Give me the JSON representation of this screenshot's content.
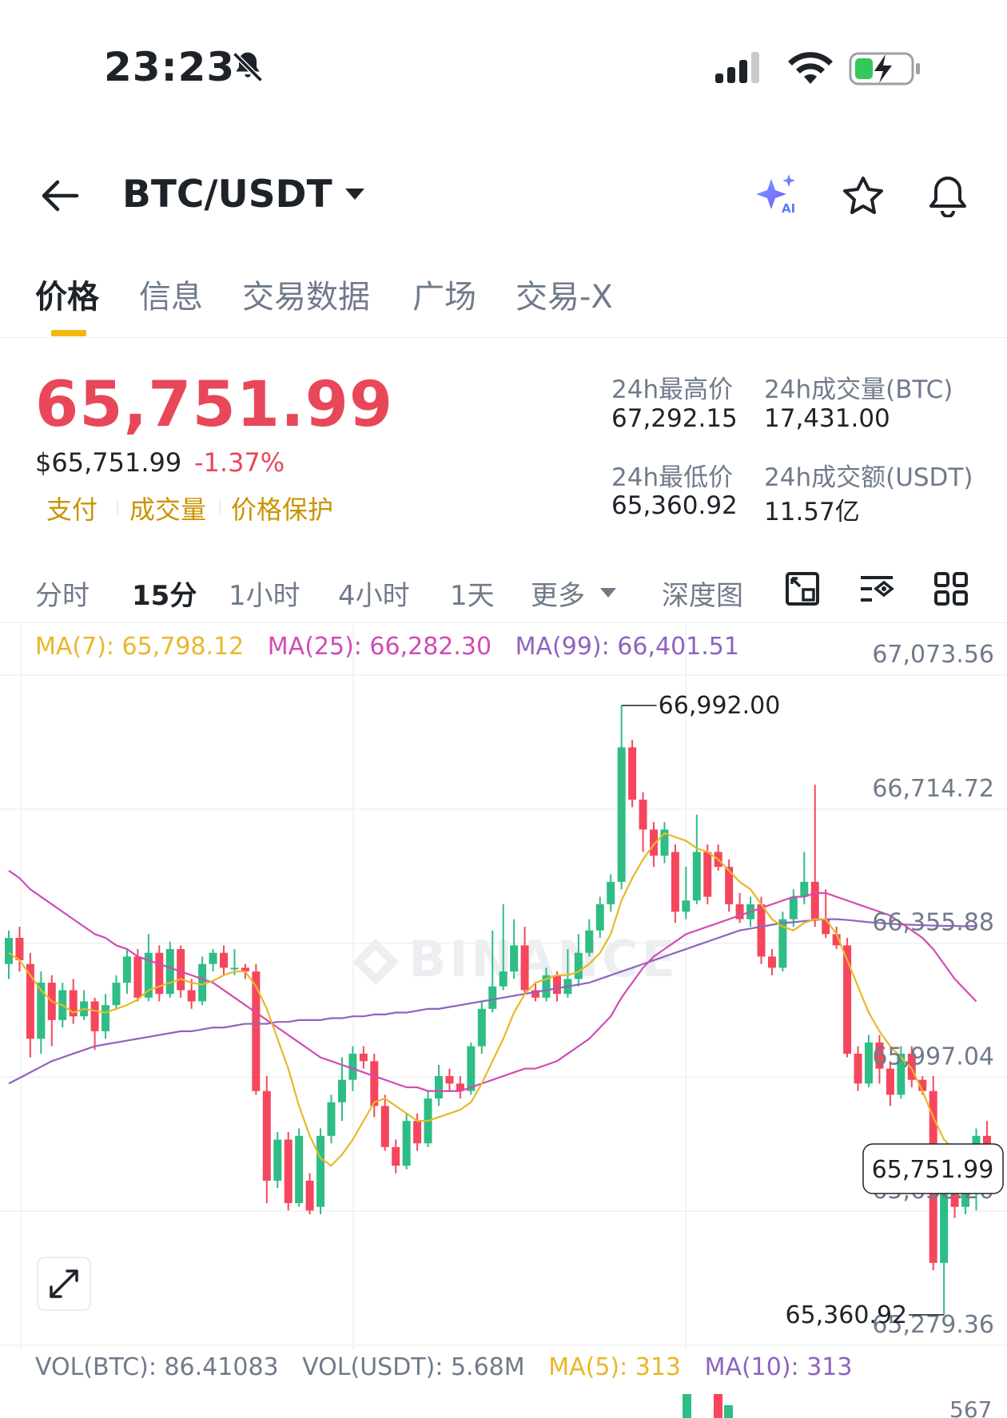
{
  "status_bar": {
    "time": "23:23"
  },
  "header": {
    "pair": "BTC/USDT"
  },
  "tabs": [
    {
      "label": "价格",
      "active": true
    },
    {
      "label": "信息",
      "active": false
    },
    {
      "label": "交易数据",
      "active": false
    },
    {
      "label": "广场",
      "active": false
    },
    {
      "label": "交易-X",
      "active": false
    }
  ],
  "price": {
    "last": "65,751.99",
    "usd": "$65,751.99",
    "change": "-1.37%",
    "tags": [
      "支付",
      "成交量",
      "价格保护"
    ]
  },
  "stats": {
    "high_label": "24h最高价",
    "high_value": "67,292.15",
    "vol_btc_label": "24h成交量(BTC)",
    "vol_btc_value": "17,431.00",
    "low_label": "24h最低价",
    "low_value": "65,360.92",
    "vol_usdt_label": "24h成交额(USDT)",
    "vol_usdt_value": "11.57亿"
  },
  "periods": [
    {
      "label": "分时",
      "active": false
    },
    {
      "label": "15分",
      "active": true
    },
    {
      "label": "1小时",
      "active": false
    },
    {
      "label": "4小时",
      "active": false
    },
    {
      "label": "1天",
      "active": false
    },
    {
      "label": "更多",
      "active": false
    },
    {
      "label": "深度图",
      "active": false
    }
  ],
  "indicators": {
    "ma7": "MA(7): 65,798.12",
    "ma25": "MA(25): 66,282.30",
    "ma99": "MA(99): 66,401.51"
  },
  "volume": {
    "vol_btc": "VOL(BTC): 86.41083",
    "vol_usdt": "VOL(USDT): 5.68M",
    "ma5": "MA(5): 313",
    "ma10": "MA(10): 313",
    "axis_top": "567"
  },
  "colors": {
    "up": "#2ebd85",
    "down": "#f6465d",
    "ma7": "#e8b829",
    "ma25": "#d24ab4",
    "ma99": "#8e63c0",
    "accent": "#f0b90b"
  },
  "chart_data": {
    "type": "candlestick",
    "watermark": "BINANCE",
    "y_ticks": [
      67073.56,
      66714.72,
      66355.88,
      65997.04,
      65638.2,
      65279.36
    ],
    "y_tick_labels": [
      "67,073.56",
      "66,714.72",
      "66,355.88",
      "65,997.04",
      "65,638.20",
      "65,279.36"
    ],
    "ylim": [
      65279.36,
      67073.56
    ],
    "high_marker": "66,992.00",
    "high_value": 66992.0,
    "low_marker": "65,360.92",
    "low_value": 65360.92,
    "last_price_label": "65,751.99",
    "last_price": 65751.99,
    "candles": [
      {
        "o": 66300,
        "c": 66370,
        "h": 66390,
        "l": 66260
      },
      {
        "o": 66370,
        "c": 66310,
        "h": 66400,
        "l": 66280
      },
      {
        "o": 66300,
        "c": 66100,
        "h": 66330,
        "l": 66050
      },
      {
        "o": 66100,
        "c": 66250,
        "h": 66280,
        "l": 66060
      },
      {
        "o": 66250,
        "c": 66150,
        "h": 66270,
        "l": 66080
      },
      {
        "o": 66150,
        "c": 66230,
        "h": 66250,
        "l": 66130
      },
      {
        "o": 66230,
        "c": 66160,
        "h": 66260,
        "l": 66140
      },
      {
        "o": 66160,
        "c": 66200,
        "h": 66230,
        "l": 66150
      },
      {
        "o": 66200,
        "c": 66120,
        "h": 66210,
        "l": 66070
      },
      {
        "o": 66120,
        "c": 66190,
        "h": 66220,
        "l": 66100
      },
      {
        "o": 66190,
        "c": 66250,
        "h": 66270,
        "l": 66180
      },
      {
        "o": 66250,
        "c": 66320,
        "h": 66340,
        "l": 66220
      },
      {
        "o": 66320,
        "c": 66210,
        "h": 66340,
        "l": 66200
      },
      {
        "o": 66210,
        "c": 66330,
        "h": 66380,
        "l": 66200
      },
      {
        "o": 66330,
        "c": 66220,
        "h": 66350,
        "l": 66200
      },
      {
        "o": 66220,
        "c": 66340,
        "h": 66360,
        "l": 66210
      },
      {
        "o": 66340,
        "c": 66230,
        "h": 66350,
        "l": 66210
      },
      {
        "o": 66230,
        "c": 66200,
        "h": 66260,
        "l": 66180
      },
      {
        "o": 66200,
        "c": 66300,
        "h": 66320,
        "l": 66190
      },
      {
        "o": 66300,
        "c": 66330,
        "h": 66340,
        "l": 66280
      },
      {
        "o": 66330,
        "c": 66290,
        "h": 66350,
        "l": 66270
      },
      {
        "o": 66290,
        "c": 66290,
        "h": 66340,
        "l": 66270
      },
      {
        "o": 66290,
        "c": 66280,
        "h": 66300,
        "l": 66260
      },
      {
        "o": 66280,
        "c": 65960,
        "h": 66300,
        "l": 65950
      },
      {
        "o": 65960,
        "c": 65720,
        "h": 66000,
        "l": 65660
      },
      {
        "o": 65720,
        "c": 65830,
        "h": 65850,
        "l": 65700
      },
      {
        "o": 65830,
        "c": 65660,
        "h": 65850,
        "l": 65640
      },
      {
        "o": 65660,
        "c": 65840,
        "h": 65860,
        "l": 65650
      },
      {
        "o": 65720,
        "c": 65640,
        "h": 65740,
        "l": 65630
      },
      {
        "o": 65650,
        "c": 65840,
        "h": 65860,
        "l": 65630
      },
      {
        "o": 65840,
        "c": 65930,
        "h": 65950,
        "l": 65820
      },
      {
        "o": 65930,
        "c": 65990,
        "h": 66050,
        "l": 65880
      },
      {
        "o": 65990,
        "c": 66060,
        "h": 66080,
        "l": 65960
      },
      {
        "o": 66060,
        "c": 66040,
        "h": 66080,
        "l": 66020
      },
      {
        "o": 66040,
        "c": 65920,
        "h": 66060,
        "l": 65890
      },
      {
        "o": 65920,
        "c": 65810,
        "h": 65950,
        "l": 65800
      },
      {
        "o": 65810,
        "c": 65760,
        "h": 65830,
        "l": 65740
      },
      {
        "o": 65760,
        "c": 65880,
        "h": 65900,
        "l": 65750
      },
      {
        "o": 65880,
        "c": 65820,
        "h": 65900,
        "l": 65800
      },
      {
        "o": 65820,
        "c": 65940,
        "h": 65960,
        "l": 65810
      },
      {
        "o": 65940,
        "c": 66000,
        "h": 66030,
        "l": 65920
      },
      {
        "o": 66000,
        "c": 65980,
        "h": 66020,
        "l": 65960
      },
      {
        "o": 65980,
        "c": 65960,
        "h": 66000,
        "l": 65940
      },
      {
        "o": 65960,
        "c": 66080,
        "h": 66090,
        "l": 65950
      },
      {
        "o": 66080,
        "c": 66180,
        "h": 66200,
        "l": 66060
      },
      {
        "o": 66180,
        "c": 66240,
        "h": 66390,
        "l": 66170
      },
      {
        "o": 66240,
        "c": 66280,
        "h": 66460,
        "l": 66230
      },
      {
        "o": 66280,
        "c": 66350,
        "h": 66420,
        "l": 66260
      },
      {
        "o": 66350,
        "c": 66230,
        "h": 66400,
        "l": 66220
      },
      {
        "o": 66230,
        "c": 66210,
        "h": 66250,
        "l": 66200
      },
      {
        "o": 66210,
        "c": 66270,
        "h": 66290,
        "l": 66200
      },
      {
        "o": 66270,
        "c": 66220,
        "h": 66280,
        "l": 66200
      },
      {
        "o": 66220,
        "c": 66260,
        "h": 66340,
        "l": 66210
      },
      {
        "o": 66260,
        "c": 66330,
        "h": 66380,
        "l": 66240
      },
      {
        "o": 66330,
        "c": 66390,
        "h": 66420,
        "l": 66320
      },
      {
        "o": 66390,
        "c": 66460,
        "h": 66480,
        "l": 66370
      },
      {
        "o": 66460,
        "c": 66520,
        "h": 66540,
        "l": 66440
      },
      {
        "o": 66520,
        "c": 66880,
        "h": 66992,
        "l": 66500
      },
      {
        "o": 66880,
        "c": 66740,
        "h": 66900,
        "l": 66720
      },
      {
        "o": 66740,
        "c": 66660,
        "h": 66760,
        "l": 66600
      },
      {
        "o": 66660,
        "c": 66590,
        "h": 66680,
        "l": 66560
      },
      {
        "o": 66590,
        "c": 66660,
        "h": 66680,
        "l": 66570
      },
      {
        "o": 66600,
        "c": 66440,
        "h": 66620,
        "l": 66410
      },
      {
        "o": 66440,
        "c": 66470,
        "h": 66560,
        "l": 66420
      },
      {
        "o": 66470,
        "c": 66600,
        "h": 66700,
        "l": 66460
      },
      {
        "o": 66600,
        "c": 66480,
        "h": 66620,
        "l": 66460
      },
      {
        "o": 66600,
        "c": 66560,
        "h": 66620,
        "l": 66550
      },
      {
        "o": 66560,
        "c": 66460,
        "h": 66580,
        "l": 66440
      },
      {
        "o": 66460,
        "c": 66420,
        "h": 66490,
        "l": 66410
      },
      {
        "o": 66420,
        "c": 66460,
        "h": 66480,
        "l": 66400
      },
      {
        "o": 66460,
        "c": 66320,
        "h": 66480,
        "l": 66300
      },
      {
        "o": 66320,
        "c": 66290,
        "h": 66340,
        "l": 66270
      },
      {
        "o": 66290,
        "c": 66420,
        "h": 66440,
        "l": 66280
      },
      {
        "o": 66420,
        "c": 66480,
        "h": 66500,
        "l": 66400
      },
      {
        "o": 66480,
        "c": 66520,
        "h": 66600,
        "l": 66460
      },
      {
        "o": 66520,
        "c": 66420,
        "h": 66780,
        "l": 66400
      },
      {
        "o": 66420,
        "c": 66380,
        "h": 66500,
        "l": 66370
      },
      {
        "o": 66380,
        "c": 66350,
        "h": 66400,
        "l": 66340
      },
      {
        "o": 66350,
        "c": 66060,
        "h": 66370,
        "l": 66050
      },
      {
        "o": 66060,
        "c": 65980,
        "h": 66080,
        "l": 65960
      },
      {
        "o": 65980,
        "c": 66090,
        "h": 66110,
        "l": 65970
      },
      {
        "o": 66090,
        "c": 66020,
        "h": 66110,
        "l": 65980
      },
      {
        "o": 66020,
        "c": 65950,
        "h": 66040,
        "l": 65920
      },
      {
        "o": 65950,
        "c": 66060,
        "h": 66080,
        "l": 65940
      },
      {
        "o": 66060,
        "c": 65990,
        "h": 66080,
        "l": 65970
      },
      {
        "o": 65990,
        "c": 65960,
        "h": 66000,
        "l": 65950
      },
      {
        "o": 65960,
        "c": 65500,
        "h": 66000,
        "l": 65480
      },
      {
        "o": 65500,
        "c": 65720,
        "h": 65740,
        "l": 65360.92
      },
      {
        "o": 65720,
        "c": 65650,
        "h": 65730,
        "l": 65620
      },
      {
        "o": 65650,
        "c": 65690,
        "h": 65760,
        "l": 65630
      },
      {
        "o": 65690,
        "c": 65840,
        "h": 65860,
        "l": 65640
      },
      {
        "o": 65840,
        "c": 65751.99,
        "h": 65880,
        "l": 65730
      }
    ],
    "ma7": [
      66330,
      66310,
      66270,
      66230,
      66200,
      66190,
      66170,
      66180,
      66175,
      66170,
      66180,
      66190,
      66205,
      66230,
      66240,
      66250,
      66260,
      66250,
      66245,
      66255,
      66270,
      66280,
      66280,
      66240,
      66180,
      66100,
      66020,
      65920,
      65840,
      65780,
      65760,
      65790,
      65830,
      65880,
      65930,
      65940,
      65920,
      65900,
      65880,
      65880,
      65890,
      65900,
      65910,
      65930,
      65980,
      66040,
      66100,
      66170,
      66220,
      66250,
      66260,
      66270,
      66270,
      66280,
      66300,
      66330,
      66380,
      66470,
      66530,
      66580,
      66620,
      66650,
      66640,
      66630,
      66610,
      66600,
      66580,
      66550,
      66520,
      66500,
      66460,
      66420,
      66400,
      66390,
      66410,
      66420,
      66420,
      66380,
      66310,
      66240,
      66170,
      66120,
      66080,
      66050,
      66020,
      65960,
      65890,
      65830,
      65800,
      65770,
      65752
    ],
    "ma25": [
      66550,
      66530,
      66500,
      66480,
      66460,
      66440,
      66420,
      66400,
      66380,
      66370,
      66350,
      66340,
      66320,
      66310,
      66300,
      66290,
      66280,
      66270,
      66260,
      66250,
      66230,
      66210,
      66190,
      66170,
      66150,
      66130,
      66110,
      66090,
      66070,
      66050,
      66040,
      66030,
      66020,
      66010,
      66000,
      65990,
      65980,
      65970,
      65970,
      65960,
      65960,
      65960,
      65960,
      65970,
      65980,
      65990,
      66000,
      66010,
      66020,
      66020,
      66030,
      66040,
      66060,
      66080,
      66100,
      66130,
      66160,
      66210,
      66250,
      66290,
      66320,
      66340,
      66360,
      66380,
      66390,
      66400,
      66410,
      66420,
      66430,
      66440,
      66450,
      66460,
      66470,
      66480,
      66480,
      66490,
      66490,
      66480,
      66470,
      66460,
      66450,
      66440,
      66430,
      66410,
      66390,
      66370,
      66340,
      66300,
      66260,
      66230,
      66200
    ],
    "ma99": [
      65980,
      65995,
      66010,
      66025,
      66040,
      66050,
      66060,
      66070,
      66080,
      66085,
      66090,
      66095,
      66100,
      66105,
      66110,
      66115,
      66120,
      66120,
      66125,
      66130,
      66130,
      66135,
      66140,
      66140,
      66140,
      66145,
      66145,
      66150,
      66150,
      66150,
      66155,
      66155,
      66160,
      66160,
      66165,
      66165,
      66170,
      66170,
      66175,
      66180,
      66180,
      66185,
      66190,
      66195,
      66200,
      66205,
      66210,
      66215,
      66220,
      66225,
      66230,
      66235,
      66240,
      66245,
      66250,
      66260,
      66270,
      66280,
      66290,
      66300,
      66310,
      66320,
      66330,
      66340,
      66350,
      66360,
      66370,
      66380,
      66390,
      66395,
      66400,
      66405,
      66410,
      66412,
      66415,
      66418,
      66420,
      66420,
      66418,
      66415,
      66412,
      66410,
      66408,
      66406,
      66405,
      66404,
      66403,
      66402,
      66402,
      66401,
      66401.51
    ]
  }
}
